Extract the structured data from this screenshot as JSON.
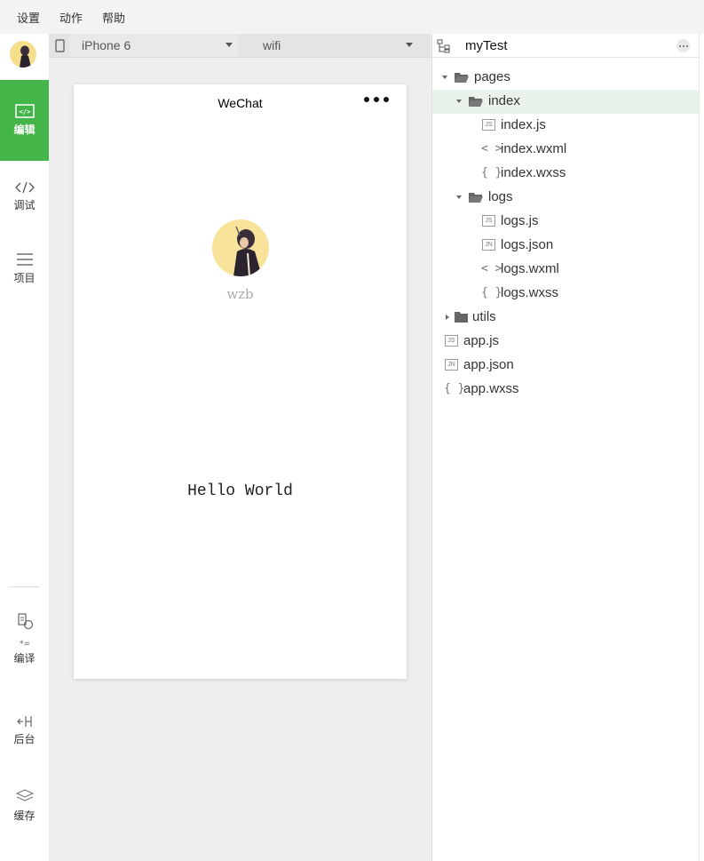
{
  "menu": {
    "settings": "设置",
    "actions": "动作",
    "help": "帮助"
  },
  "sidebar": {
    "edit": "编辑",
    "debug": "调试",
    "project": "项目",
    "compile": "编译",
    "background": "后台",
    "cache": "缓存",
    "accent": "#44b549"
  },
  "simulator": {
    "device": "iPhone 6",
    "network": "wifi",
    "nav_title": "WeChat",
    "nickname": "wzb",
    "motto": "Hello World"
  },
  "explorer": {
    "project": "myTest",
    "tree": {
      "pages": "pages",
      "index": "index",
      "index_js": "index.js",
      "index_wxml": "index.wxml",
      "index_wxss": "index.wxss",
      "logs": "logs",
      "logs_js": "logs.js",
      "logs_json": "logs.json",
      "logs_wxml": "logs.wxml",
      "logs_wxss": "logs.wxss",
      "utils": "utils",
      "app_js": "app.js",
      "app_json": "app.json",
      "app_wxss": "app.wxss"
    },
    "badges": {
      "js": "JS",
      "json": "JN",
      "wxml": "< >",
      "wxss": "{ }"
    }
  }
}
